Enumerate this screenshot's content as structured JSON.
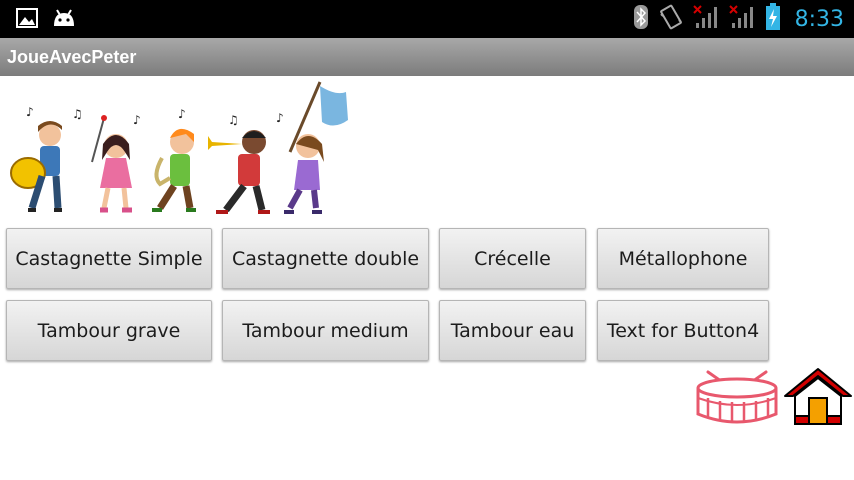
{
  "status_bar": {
    "time": "8:33",
    "left_icons": [
      "image-icon",
      "android-icon"
    ],
    "right_icons": [
      "bluetooth-icon",
      "vibrate-icon",
      "signal-no-service-icon",
      "signal-no-service-icon",
      "battery-charging-icon"
    ]
  },
  "app": {
    "title": "JoueAvecPeter"
  },
  "buttons": {
    "row1": [
      "Castagnette Simple",
      "Castagnette double",
      "Crécelle",
      "Métallophone"
    ],
    "row2": [
      "Tambour grave",
      "Tambour medium",
      "Tambour eau",
      "Text for Button4"
    ]
  },
  "colors": {
    "status_bar_bg": "#000000",
    "clock": "#33b5e5",
    "title_bar_bg": "#8e8e8e",
    "button_bg": "#e4e4e4",
    "drum_icon": "#e8586d",
    "home_icon": "#d20000"
  }
}
